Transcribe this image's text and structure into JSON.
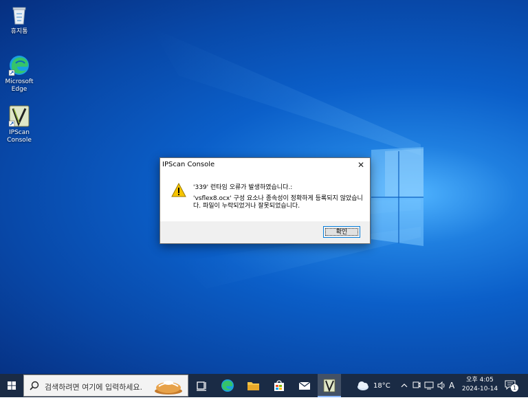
{
  "desktop": {
    "icons": [
      {
        "label": "휴지통",
        "icon": "recycle-bin-icon"
      },
      {
        "label": "Microsoft Edge",
        "icon": "edge-icon"
      },
      {
        "label": "IPScan Console",
        "icon": "ipscan-icon"
      }
    ]
  },
  "dialog": {
    "title": "IPScan Console",
    "close_glyph": "✕",
    "message_line1": "'339' 런타임 오류가 발생하였습니다.:",
    "message_line2": "'vsflex8.ocx' 구성 요소나 종속성이 정확하게 등록되지 않았습니다. 파일이 누락되었거나 잘못되었습니다.",
    "ok_label": "확인",
    "icon": "warning-icon"
  },
  "taskbar": {
    "search_placeholder": "검색하려면 여기에 입력하세요.",
    "weather_temp": "18°C",
    "ime_label": "A",
    "clock_period_time": "오후 4:05",
    "clock_date": "2024-10-14",
    "notification_count": "1",
    "colors": {
      "taskbar": "#1a2b45",
      "accent": "#0078d7"
    }
  }
}
